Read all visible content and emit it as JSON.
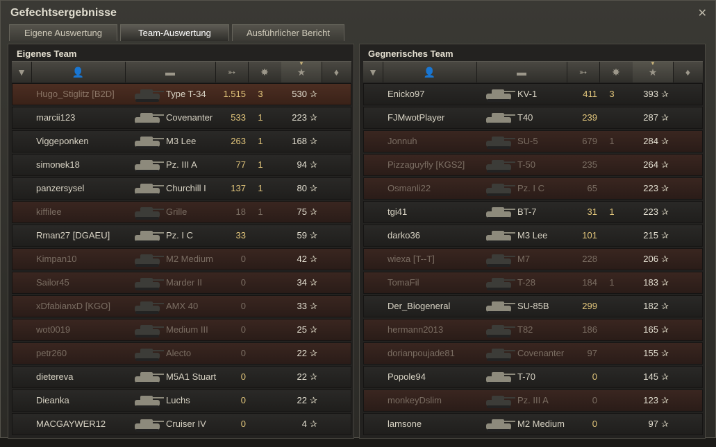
{
  "window": {
    "title": "Gefechtsergebnisse",
    "close_icon": "close-icon"
  },
  "tabs": [
    {
      "label": "Eigene Auswertung",
      "active": false
    },
    {
      "label": "Team-Auswertung",
      "active": true
    },
    {
      "label": "Ausführlicher Bericht",
      "active": false
    }
  ],
  "own_team": {
    "title": "Eigenes Team",
    "rows": [
      {
        "name": "Hugo_Stiglitz [B2D]",
        "vehicle": "Type T-34",
        "damage": "1.515",
        "kills": "3",
        "xp": "530",
        "state": "player"
      },
      {
        "name": "marcii123",
        "vehicle": "Covenanter",
        "damage": "533",
        "kills": "1",
        "xp": "223",
        "state": "alive"
      },
      {
        "name": "Viggeponken",
        "vehicle": "M3 Lee",
        "damage": "263",
        "kills": "1",
        "xp": "168",
        "state": "alive"
      },
      {
        "name": "simonek18",
        "vehicle": "Pz. III A",
        "damage": "77",
        "kills": "1",
        "xp": "94",
        "state": "alive"
      },
      {
        "name": "panzersysel",
        "vehicle": "Churchill I",
        "damage": "137",
        "kills": "1",
        "xp": "80",
        "state": "alive"
      },
      {
        "name": "kiffilee",
        "vehicle": "Grille",
        "damage": "18",
        "kills": "1",
        "xp": "75",
        "state": "dead"
      },
      {
        "name": "Rman27 [DGAEU]",
        "vehicle": "Pz. I C",
        "damage": "33",
        "kills": "",
        "xp": "59",
        "state": "alive"
      },
      {
        "name": "Kimpan10",
        "vehicle": "M2 Medium",
        "damage": "0",
        "kills": "",
        "xp": "42",
        "state": "dead"
      },
      {
        "name": "Sailor45",
        "vehicle": "Marder II",
        "damage": "0",
        "kills": "",
        "xp": "34",
        "state": "dead"
      },
      {
        "name": "xDfabianxD [KGO]",
        "vehicle": "AMX 40",
        "damage": "0",
        "kills": "",
        "xp": "33",
        "state": "dead"
      },
      {
        "name": "wot0019",
        "vehicle": "Medium III",
        "damage": "0",
        "kills": "",
        "xp": "25",
        "state": "dead"
      },
      {
        "name": "petr260",
        "vehicle": "Alecto",
        "damage": "0",
        "kills": "",
        "xp": "22",
        "state": "dead"
      },
      {
        "name": "dietereva",
        "vehicle": "M5A1 Stuart",
        "damage": "0",
        "kills": "",
        "xp": "22",
        "state": "alive"
      },
      {
        "name": "Dieanka",
        "vehicle": "Luchs",
        "damage": "0",
        "kills": "",
        "xp": "22",
        "state": "alive"
      },
      {
        "name": "MACGAYWER12",
        "vehicle": "Cruiser IV",
        "damage": "0",
        "kills": "",
        "xp": "4",
        "state": "alive"
      }
    ]
  },
  "enemy_team": {
    "title": "Gegnerisches Team",
    "rows": [
      {
        "name": "Enicko97",
        "vehicle": "KV-1",
        "damage": "411",
        "kills": "3",
        "xp": "393",
        "state": "alive"
      },
      {
        "name": "FJMwotPlayer",
        "vehicle": "T40",
        "damage": "239",
        "kills": "",
        "xp": "287",
        "state": "alive"
      },
      {
        "name": "Jonnuh",
        "vehicle": "SU-5",
        "damage": "679",
        "kills": "1",
        "xp": "284",
        "state": "dead"
      },
      {
        "name": "Pizzaguyfly [KGS2]",
        "vehicle": "T-50",
        "damage": "235",
        "kills": "",
        "xp": "264",
        "state": "dead"
      },
      {
        "name": "Osmanli22",
        "vehicle": "Pz. I C",
        "damage": "65",
        "kills": "",
        "xp": "223",
        "state": "dead"
      },
      {
        "name": "tgi41",
        "vehicle": "BT-7",
        "damage": "31",
        "kills": "1",
        "xp": "223",
        "state": "alive"
      },
      {
        "name": "darko36",
        "vehicle": "M3 Lee",
        "damage": "101",
        "kills": "",
        "xp": "215",
        "state": "alive"
      },
      {
        "name": "wiexa [T--T]",
        "vehicle": "M7",
        "damage": "228",
        "kills": "",
        "xp": "206",
        "state": "dead"
      },
      {
        "name": "TomaFil",
        "vehicle": "T-28",
        "damage": "184",
        "kills": "1",
        "xp": "183",
        "state": "dead"
      },
      {
        "name": "Der_Biogeneral",
        "vehicle": "SU-85B",
        "damage": "299",
        "kills": "",
        "xp": "182",
        "state": "alive"
      },
      {
        "name": "hermann2013",
        "vehicle": "T82",
        "damage": "186",
        "kills": "",
        "xp": "165",
        "state": "dead"
      },
      {
        "name": "dorianpoujade81",
        "vehicle": "Covenanter",
        "damage": "97",
        "kills": "",
        "xp": "155",
        "state": "dead"
      },
      {
        "name": "Popole94",
        "vehicle": "T-70",
        "damage": "0",
        "kills": "",
        "xp": "145",
        "state": "alive"
      },
      {
        "name": "monkeyDslim",
        "vehicle": "Pz. III A",
        "damage": "0",
        "kills": "",
        "xp": "123",
        "state": "dead"
      },
      {
        "name": "lamsone",
        "vehicle": "M2 Medium",
        "damage": "0",
        "kills": "",
        "xp": "97",
        "state": "alive"
      }
    ]
  },
  "columns": [
    {
      "id": "tier",
      "icon": "tier-badge-icon"
    },
    {
      "id": "player",
      "icon": "player-icon"
    },
    {
      "id": "vehicle",
      "icon": "tank-icon"
    },
    {
      "id": "damage",
      "icon": "damage-icon"
    },
    {
      "id": "kills",
      "icon": "destroyed-tank-icon"
    },
    {
      "id": "xp",
      "icon": "xp-star-icon",
      "sorted": true
    },
    {
      "id": "medals",
      "icon": "medal-icon"
    }
  ],
  "colors": {
    "accent": "#e3c77c",
    "dead_row": "#3a2620",
    "alive_row": "#2a2927"
  }
}
